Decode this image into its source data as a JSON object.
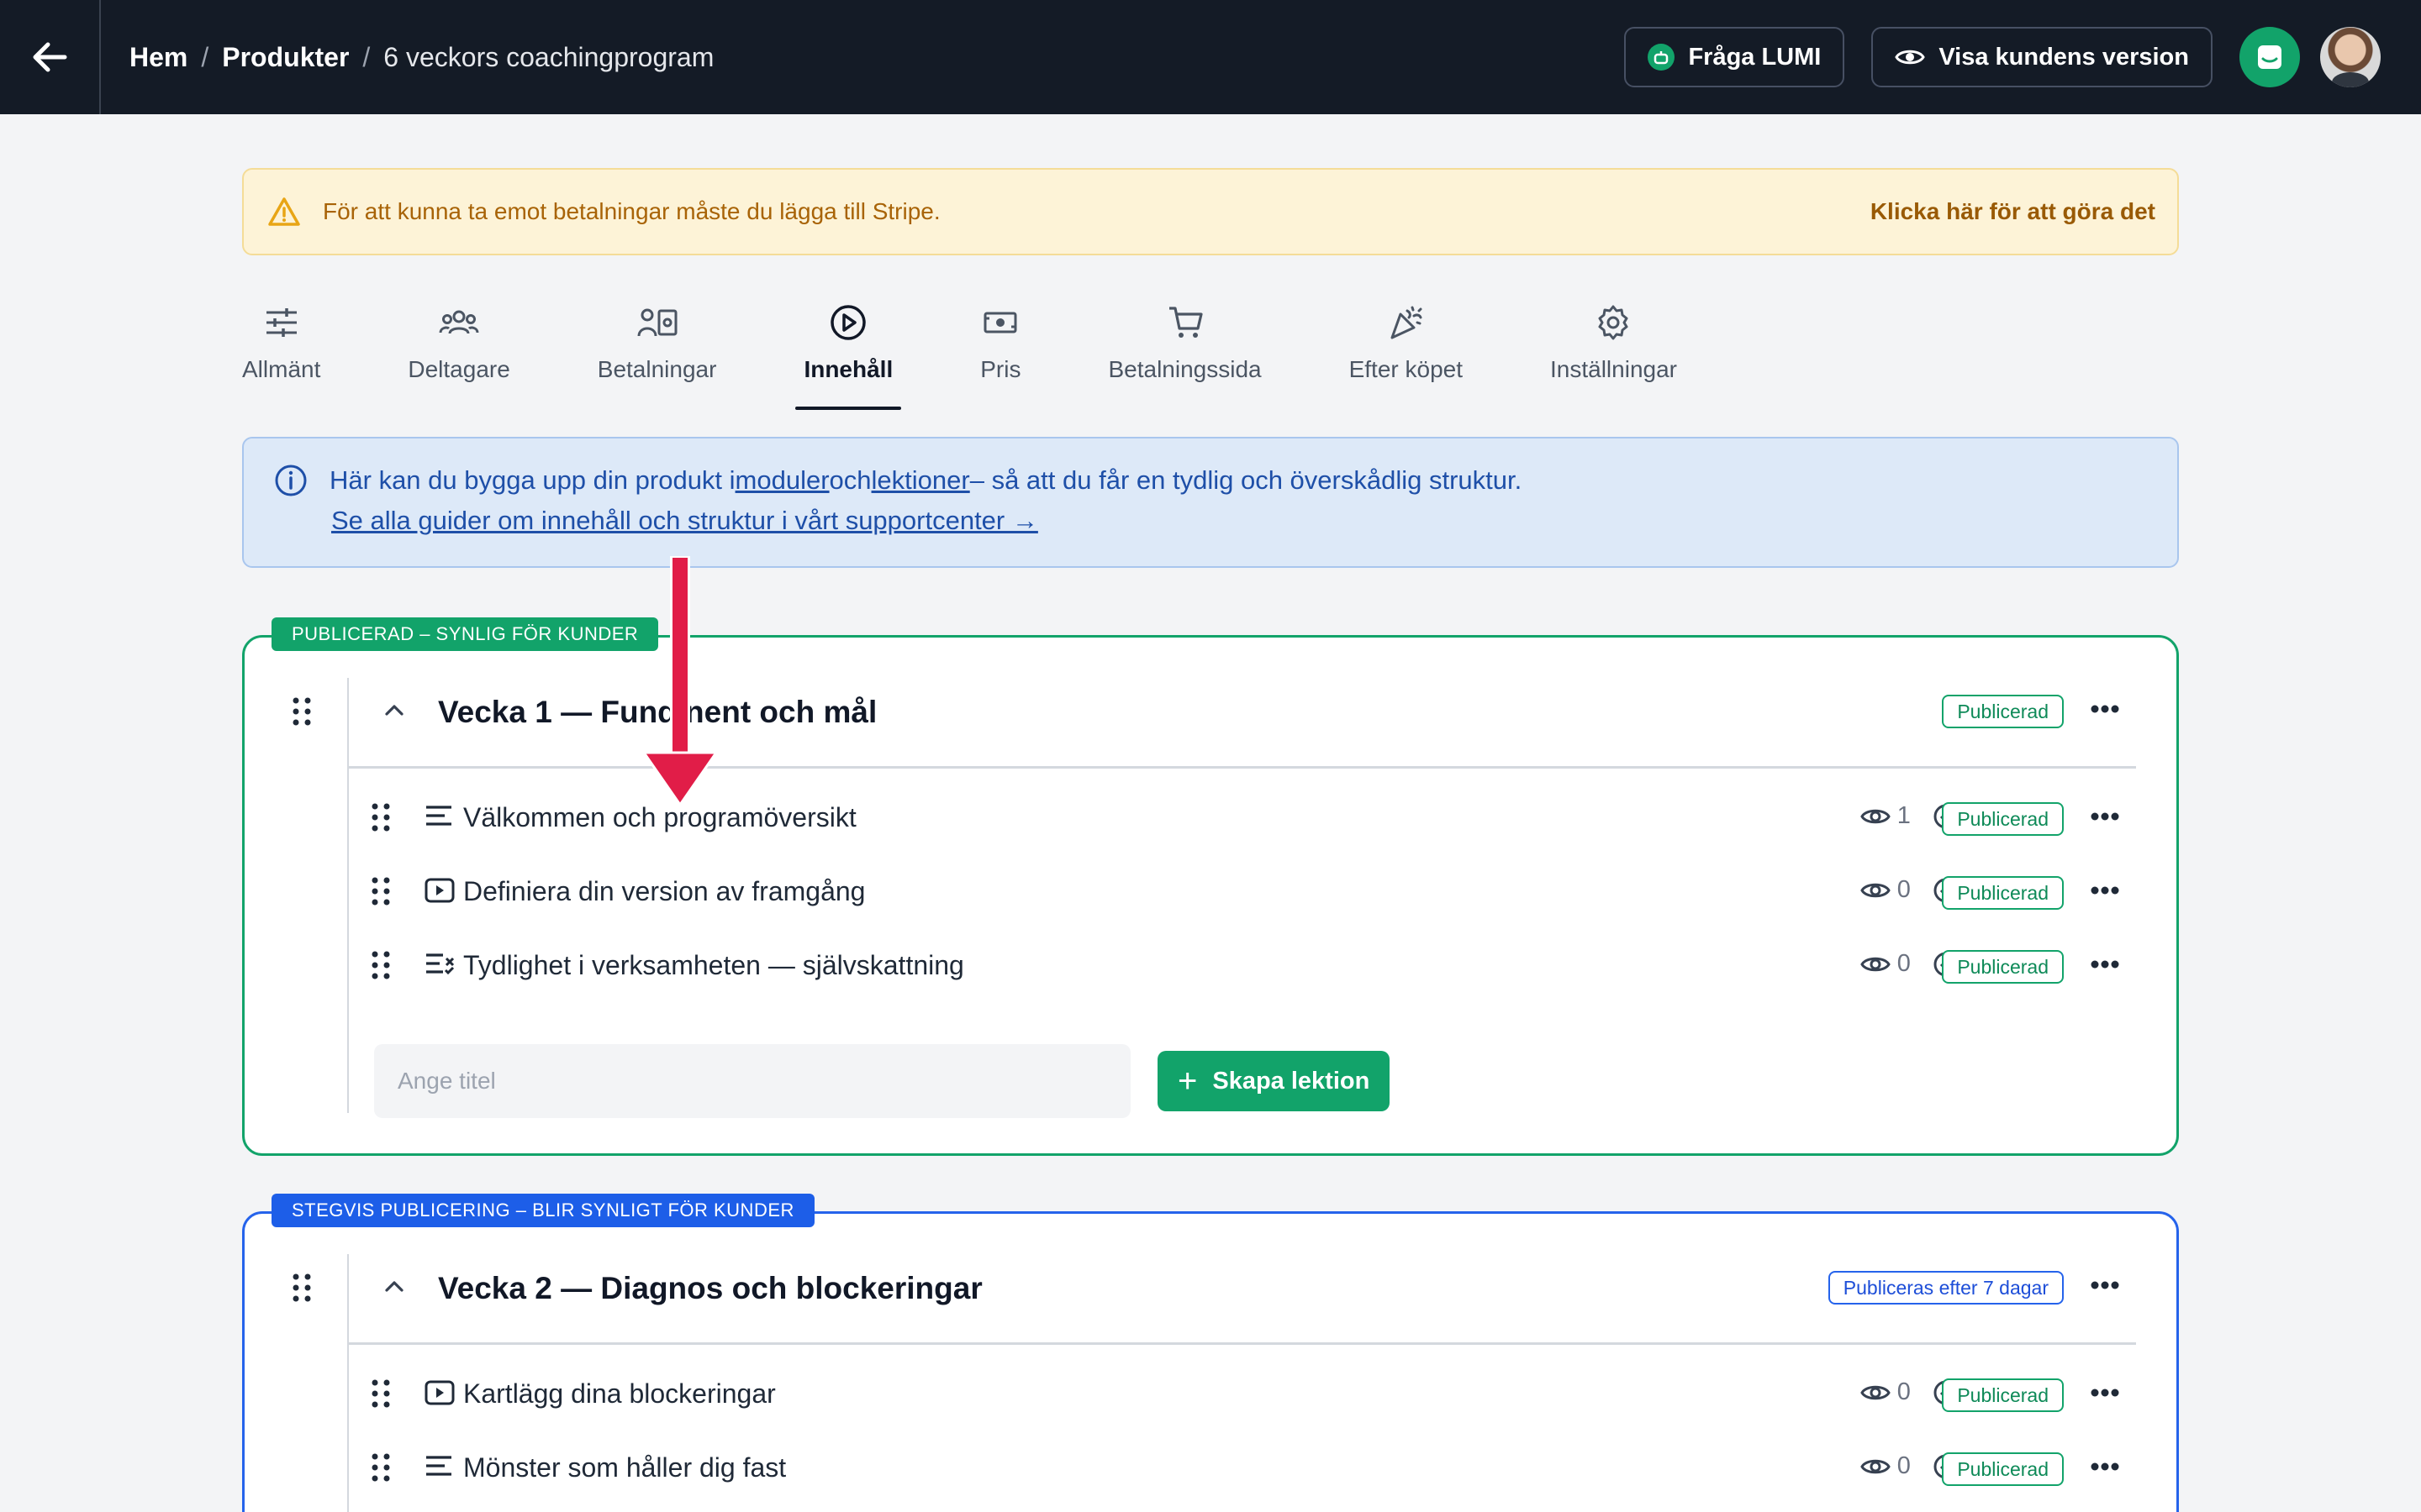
{
  "header": {
    "breadcrumb": [
      "Hem",
      "Produkter",
      "6 veckors coachingprogram"
    ],
    "ask_button": "Fråga LUMI",
    "customer_view_button": "Visa kundens version"
  },
  "warning": {
    "text": "För att kunna ta emot betalningar måste du lägga till Stripe.",
    "link": "Klicka här för att göra det"
  },
  "tabs": [
    {
      "label": "Allmänt",
      "icon": "sliders-icon"
    },
    {
      "label": "Deltagare",
      "icon": "users-icon"
    },
    {
      "label": "Betalningar",
      "icon": "payments-icon"
    },
    {
      "label": "Innehåll",
      "icon": "play-circle-icon",
      "active": true
    },
    {
      "label": "Pris",
      "icon": "banknote-icon"
    },
    {
      "label": "Betalningssida",
      "icon": "cart-icon"
    },
    {
      "label": "Efter köpet",
      "icon": "party-icon"
    },
    {
      "label": "Inställningar",
      "icon": "gear-icon"
    }
  ],
  "info": {
    "text_a": "Här kan du bygga upp din produkt i",
    "link_modules": "moduler",
    "text_b": "och",
    "link_lessons": "lektioner",
    "text_c": "– så att du får en tydlig och överskådlig struktur.",
    "guide_link": "Se alla guider om innehåll och struktur i vårt supportcenter →"
  },
  "modules": [
    {
      "label": "PUBLICERAD – SYNLIG FÖR KUNDER",
      "title": "Vecka 1 — Fund  nent och mål",
      "status": "Publicerad",
      "lessons": [
        {
          "title": "Välkommen och programöversikt",
          "type": "text-icon",
          "views": "1",
          "completed": "0",
          "status": "Publicerad"
        },
        {
          "title": "Definiera din version av framgång",
          "type": "video-icon",
          "views": "0",
          "completed": "0",
          "status": "Publicerad"
        },
        {
          "title": "Tydlighet i verksamheten — självskattning",
          "type": "quiz-icon",
          "views": "0",
          "completed": "0",
          "status": "Publicerad"
        }
      ],
      "new_lesson_placeholder": "Ange titel",
      "create_button": "Skapa lektion"
    },
    {
      "label": "STEGVIS PUBLICERING – BLIR SYNLIGT FÖR KUNDER",
      "title": "Vecka 2 — Diagnos och blockeringar",
      "status": "Publiceras efter 7 dagar",
      "lessons": [
        {
          "title": "Kartlägg dina blockeringar",
          "type": "video-icon",
          "views": "0",
          "completed": "0",
          "status": "Publicerad"
        },
        {
          "title": "Mönster som håller dig fast",
          "type": "text-icon",
          "views": "0",
          "completed": "0",
          "status": "Publicerad"
        }
      ]
    }
  ],
  "colors": {
    "topbar": "#141b26",
    "accent_green": "#12a36a",
    "accent_blue": "#2563eb",
    "annotation_red": "#e11d48"
  }
}
